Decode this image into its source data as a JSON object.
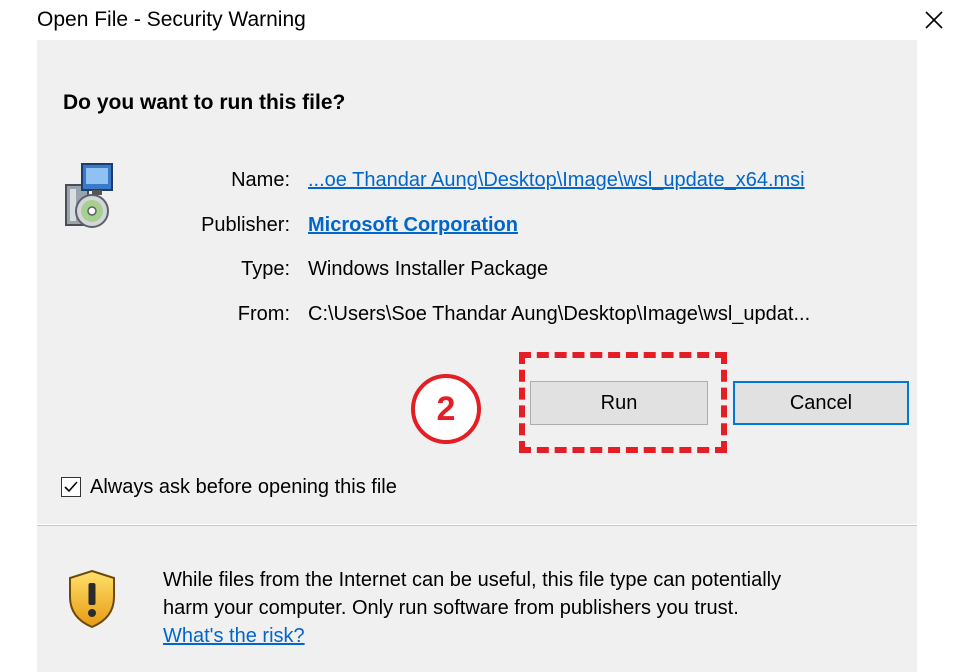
{
  "window": {
    "title": "Open File - Security Warning",
    "close_label": "×"
  },
  "dialog": {
    "question": "Do you want to run this file?",
    "fields": {
      "name_label": "Name:",
      "name_value": "...oe Thandar Aung\\Desktop\\Image\\wsl_update_x64.msi",
      "publisher_label": "Publisher:",
      "publisher_value": "Microsoft Corporation",
      "type_label": "Type:",
      "type_value": "Windows Installer Package",
      "from_label": "From:",
      "from_value": "C:\\Users\\Soe Thandar Aung\\Desktop\\Image\\wsl_updat..."
    },
    "buttons": {
      "run": "Run",
      "cancel": "Cancel"
    },
    "annotation_step": "2",
    "checkbox": {
      "label": "Always ask before opening this file",
      "checked": true
    }
  },
  "warning": {
    "line1": "While files from the Internet can be useful, this file type can potentially",
    "line2": "harm your computer. Only run software from publishers you trust.",
    "link": "What's the risk?"
  },
  "icons": {
    "installer": "installer-package-icon",
    "shield": "security-shield-icon",
    "close": "close-icon",
    "check": "checkmark-icon"
  },
  "colors": {
    "link": "#0066cc",
    "annotation": "#e31e24",
    "default_button_border": "#0078d7",
    "panel": "#f0f0f0"
  }
}
